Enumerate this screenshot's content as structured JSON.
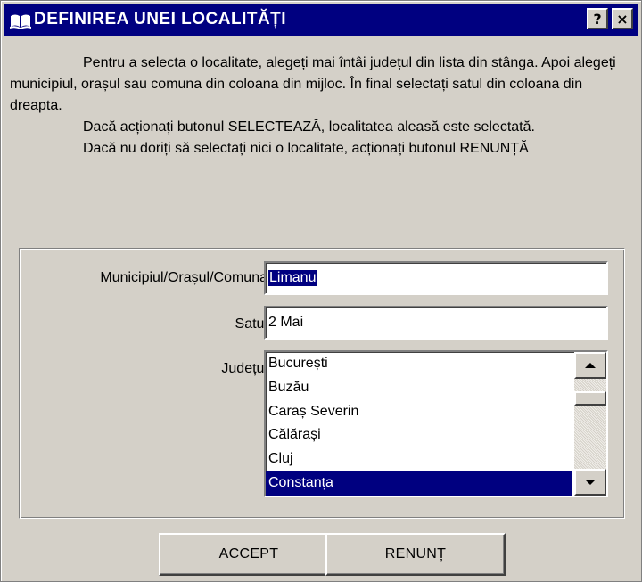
{
  "window": {
    "title": "DEFINIREA UNEI LOCALITĂȚI",
    "help_button": "?",
    "close_button": "×"
  },
  "instructions": [
    "Pentru a selecta o localitate, alegeți mai întâi județul din lista din stânga. Apoi alegeți municipiul, orașul sau comuna din coloana din mijloc. În final selectați satul din coloana din dreapta.",
    "Dacă acționați butonul SELECTEAZĂ, localitatea aleasă este selectată.",
    "Dacă nu doriți să selectați nici o localitate, acționați butonul RENUNȚĂ"
  ],
  "form": {
    "municipiu_label": "Municipiul/Orașul/Comuna",
    "municipiu_value": "Limanu",
    "sat_label": "Satul",
    "sat_value": "2 Mai",
    "judet_label": "Județul",
    "judete": [
      "București",
      "Buzău",
      "Caraș Severin",
      "Călărași",
      "Cluj",
      "Constanța"
    ],
    "judet_selected": "Constanța"
  },
  "buttons": {
    "accept": "ACCEPT",
    "renunt": "RENUNȚ"
  },
  "colors": {
    "titlebar": "#000080",
    "selection": "#000080",
    "face": "#d4d0c8"
  }
}
